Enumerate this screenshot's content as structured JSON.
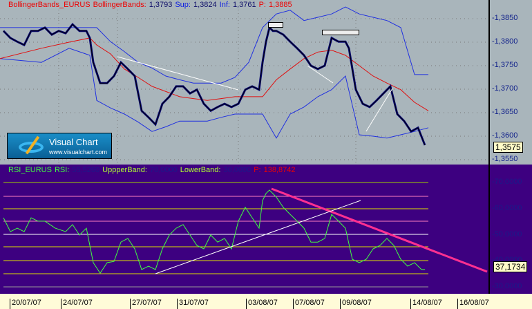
{
  "price_panel": {
    "header": {
      "name": "BollingerBands_EURUS",
      "ind": "BollingerBands:",
      "value": "1,3793",
      "sup_label": "Sup:",
      "sup": "1,3824",
      "inf_label": "Inf:",
      "inf": "1,3761",
      "p_label": "P:",
      "p": "1,3885"
    },
    "axis_ticks": [
      "1,3850",
      "1,3800",
      "1,3750",
      "1,3700",
      "1,3650",
      "1,3600",
      "1,3550"
    ],
    "tick_values": [
      1.385,
      1.38,
      1.375,
      1.37,
      1.365,
      1.36,
      1.355
    ],
    "last_price": "1,3575",
    "logo": {
      "title": "Visual Chart",
      "url": "www.visualchart.com"
    }
  },
  "rsi_panel": {
    "header": {
      "name": "RSI_EURUS",
      "rsi_label": "RSI:",
      "rsi": "55,5260",
      "upper_label": "UppperBand:",
      "upper": "70,0000",
      "lower_label": "LowerBand:",
      "lower": "30,0000",
      "p_label": "P:",
      "p": "138,8742"
    },
    "axis_ticks": [
      "70,0000",
      "60,0000",
      "50,0000",
      "40,0000",
      "30,0000"
    ],
    "tick_values": [
      70,
      60,
      50,
      40,
      30
    ],
    "last_value": "37,1734"
  },
  "dates": [
    "20/07/07",
    "24/07/07",
    "27/07/07",
    "31/07/07",
    "03/08/07",
    "07/08/07",
    "09/08/07",
    "14/08/07",
    "16/08/07"
  ],
  "colors": {
    "price": "#0a0a7a",
    "upper": "#2030e0",
    "lower": "#2030e0",
    "middle": "#e01010",
    "rsi": "#40ff40"
  },
  "chart_data": {
    "type": "line",
    "price": {
      "bars": [
        5,
        15,
        25,
        35,
        45,
        55,
        65,
        75,
        85,
        95,
        105,
        115,
        125,
        130,
        135,
        145,
        155,
        165,
        175,
        185,
        195,
        205,
        215,
        225,
        235,
        245,
        255,
        265,
        275,
        285,
        295,
        305,
        315,
        325,
        335,
        345,
        355,
        365,
        375,
        380,
        385,
        390,
        395,
        400,
        410,
        420,
        430,
        440,
        450,
        460,
        470,
        480,
        490,
        500,
        505,
        510,
        515,
        525,
        535,
        545,
        555,
        565,
        575,
        585,
        595,
        605,
        615
      ],
      "close": [
        1.3824,
        1.3809,
        1.3801,
        1.3794,
        1.3824,
        1.3824,
        1.3831,
        1.3816,
        1.3824,
        1.3819,
        1.3838,
        1.3824,
        1.3824,
        1.3809,
        1.3757,
        1.3713,
        1.3713,
        1.3728,
        1.3757,
        1.3743,
        1.3728,
        1.3654,
        1.364,
        1.3625,
        1.3669,
        1.3684,
        1.3706,
        1.3706,
        1.3691,
        1.3699,
        1.3669,
        1.3654,
        1.3662,
        1.3669,
        1.3662,
        1.3669,
        1.3699,
        1.3706,
        1.3699,
        1.3757,
        1.3801,
        1.3831,
        1.3824,
        1.3824,
        1.3816,
        1.3801,
        1.3787,
        1.3772,
        1.375,
        1.3743,
        1.375,
        1.3809,
        1.3801,
        1.3801,
        1.3787,
        1.3743,
        1.3699,
        1.3669,
        1.3662,
        1.3676,
        1.3691,
        1.3706,
        1.3647,
        1.3632,
        1.361,
        1.3618,
        1.3581
      ]
    },
    "bands": {
      "bars": [
        0,
        60,
        100,
        130,
        140,
        160,
        180,
        200,
        220,
        240,
        260,
        280,
        300,
        320,
        340,
        360,
        380,
        400,
        420,
        440,
        460,
        480,
        500,
        520,
        540,
        560,
        580,
        600,
        620
      ],
      "upper": [
        1.3831,
        1.3831,
        1.3831,
        1.3831,
        1.3831,
        1.3801,
        1.378,
        1.3757,
        1.3745,
        1.3728,
        1.372,
        1.3713,
        1.3713,
        1.3713,
        1.3725,
        1.3757,
        1.3831,
        1.386,
        1.3868,
        1.3846,
        1.3853,
        1.386,
        1.3875,
        1.386,
        1.3853,
        1.3846,
        1.3831,
        1.3731,
        1.3731
      ],
      "middle": [
        1.3765,
        1.3787,
        1.38,
        1.3809,
        1.3794,
        1.3775,
        1.3743,
        1.3725,
        1.3706,
        1.3695,
        1.3684,
        1.368,
        1.3676,
        1.368,
        1.3684,
        1.3684,
        1.3684,
        1.372,
        1.3743,
        1.3765,
        1.3779,
        1.3783,
        1.3772,
        1.375,
        1.3728,
        1.3713,
        1.3699,
        1.3672,
        1.3654
      ],
      "lower": [
        1.3765,
        1.3757,
        1.3787,
        1.3772,
        1.3676,
        1.366,
        1.3647,
        1.363,
        1.361,
        1.362,
        1.3632,
        1.3632,
        1.3632,
        1.364,
        1.3647,
        1.3647,
        1.3647,
        1.3596,
        1.3647,
        1.3662,
        1.3684,
        1.3699,
        1.3728,
        1.3603,
        1.36,
        1.3596,
        1.3603,
        1.361,
        1.3618
      ]
    },
    "rsi": {
      "bars": [
        5,
        15,
        25,
        35,
        45,
        55,
        65,
        80,
        95,
        105,
        115,
        125,
        135,
        145,
        155,
        165,
        175,
        185,
        195,
        205,
        215,
        225,
        235,
        245,
        255,
        265,
        275,
        285,
        295,
        305,
        315,
        325,
        335,
        345,
        355,
        365,
        375,
        380,
        385,
        390,
        400,
        410,
        420,
        430,
        440,
        450,
        460,
        470,
        480,
        490,
        500,
        510,
        520,
        530,
        540,
        550,
        560,
        570,
        580,
        590,
        600,
        610,
        615
      ],
      "values": [
        56.5,
        51.2,
        52.5,
        51.2,
        56.5,
        55.2,
        55.2,
        52.5,
        51.2,
        53.9,
        49.9,
        52.5,
        39.3,
        35.3,
        39.3,
        39.8,
        47.2,
        48.6,
        44.6,
        36.7,
        38.0,
        36.7,
        44.6,
        49.9,
        52.5,
        53.9,
        49.9,
        45.9,
        44.6,
        49.9,
        47.2,
        48.6,
        44.6,
        55.2,
        60.5,
        56.5,
        52.5,
        63.1,
        65.8,
        67.1,
        64.4,
        60.5,
        57.8,
        55.2,
        52.5,
        47.2,
        47.2,
        48.6,
        57.8,
        55.2,
        52.5,
        40.6,
        39.3,
        40.6,
        44.6,
        45.9,
        48.6,
        45.9,
        40.6,
        38.0,
        39.3,
        36.7,
        36.7
      ],
      "ylim": [
        25,
        75
      ],
      "levels": [
        70,
        30
      ]
    },
    "price_ylim": [
      1.3535,
      1.3885
    ]
  }
}
